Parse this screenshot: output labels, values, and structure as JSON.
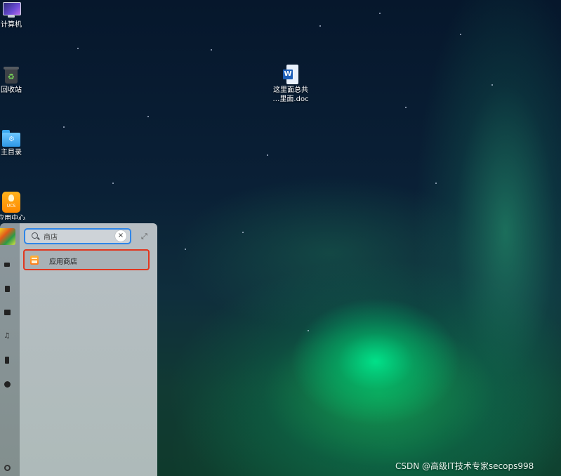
{
  "desktop": {
    "icons": [
      {
        "label": "计算机"
      },
      {
        "label": "回收站"
      },
      {
        "label": "主目录"
      },
      {
        "label": "UCS",
        "caption": "应用中心"
      },
      {
        "label": "这里面总共\n…里面.doc"
      }
    ]
  },
  "launcher": {
    "search": {
      "value": "商店",
      "clear_label": "×"
    },
    "expand_glyph": "⤢",
    "results": [
      {
        "label": "应用商店"
      }
    ],
    "sidebar": [
      "computer-icon",
      "document-icon",
      "picture-icon",
      "music-icon",
      "video-icon",
      "download-icon",
      "settings-icon"
    ]
  },
  "watermark": "CSDN @高级IT技术专家secops998"
}
